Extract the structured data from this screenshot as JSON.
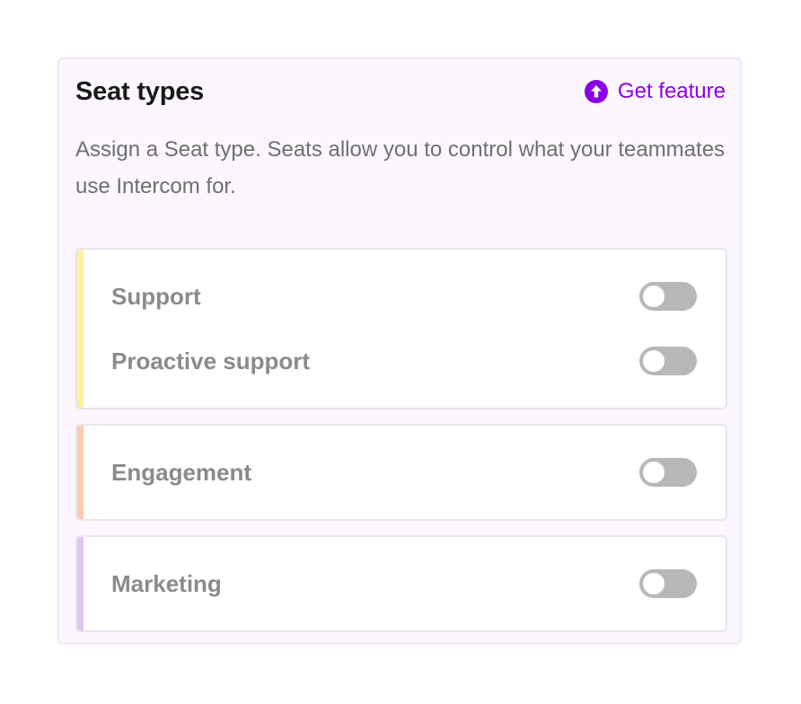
{
  "header": {
    "title": "Seat types",
    "get_feature_label": "Get feature",
    "get_feature_icon": "arrow-up-circle-icon"
  },
  "description": "Assign a Seat type. Seats allow you to control what your teammates use Intercom for.",
  "colors": {
    "accent": "#8a00e6",
    "panel_bg": "#fcf7fe",
    "toggle_off": "#b8b8b8",
    "stripe_support": "#fef1a3",
    "stripe_engagement": "#ffc9b0",
    "stripe_marketing": "#dcc6f4"
  },
  "groups": [
    {
      "items": [
        {
          "label": "Support",
          "enabled": false
        },
        {
          "label": "Proactive support",
          "enabled": false
        }
      ]
    },
    {
      "items": [
        {
          "label": "Engagement",
          "enabled": false
        }
      ]
    },
    {
      "items": [
        {
          "label": "Marketing",
          "enabled": false
        }
      ]
    }
  ]
}
